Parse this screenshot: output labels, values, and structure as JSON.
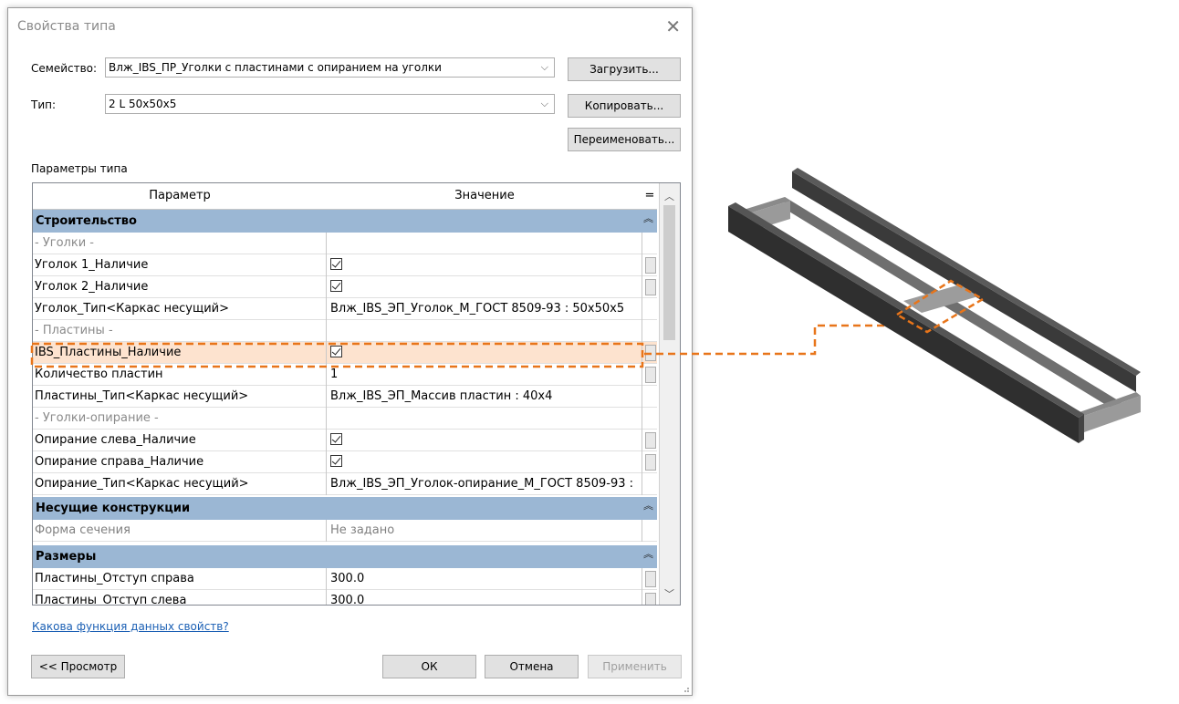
{
  "dialog": {
    "title": "Свойства типа",
    "family_label": "Семейство:",
    "family_value": "Влж_IBS_ПР_Уголки с пластинами с опиранием на уголки",
    "type_label": "Тип:",
    "type_value": "2 L 50x50x5",
    "load_button": "Загрузить...",
    "copy_button": "Копировать...",
    "rename_button": "Переименовать...",
    "params_label": "Параметры типа",
    "help_link": "Какова функция данных свойств?",
    "preview_button": "<< Просмотр",
    "ok_button": "ОК",
    "cancel_button": "Отмена",
    "apply_button": "Применить"
  },
  "grid": {
    "col_param": "Параметр",
    "col_value": "Значение",
    "col_eq": "=",
    "groups": {
      "construction": "Строительство",
      "bearing": "Несущие конструкции",
      "dimensions": "Размеры"
    },
    "rows": {
      "sub_angles": "- Уголки -",
      "angle1": "Уголок 1_Наличие",
      "angle2": "Уголок 2_Наличие",
      "angle_type": "Уголок_Тип<Каркас несущий>",
      "angle_type_val": "Влж_IBS_ЭП_Уголок_М_ГОСТ 8509-93 : 50x50x5",
      "sub_plates": "- Пластины -",
      "plates_present": "IBS_Пластины_Наличие",
      "plates_count": "Количество пластин",
      "plates_count_val": "1",
      "plates_type": "Пластины_Тип<Каркас несущий>",
      "plates_type_val": "Влж_IBS_ЭП_Массив пластин : 40x4",
      "sub_support": "- Уголки-опирание -",
      "support_left": "Опирание слева_Наличие",
      "support_right": "Опирание справа_Наличие",
      "support_type": "Опирание_Тип<Каркас несущий>",
      "support_type_val": "Влж_IBS_ЭП_Уголок-опирание_М_ГОСТ 8509-93 :",
      "section_shape": "Форма сечения",
      "section_shape_val": "Не задано",
      "offset_right": "Пластины_Отступ справа",
      "offset_right_val": "300.0",
      "offset_left": "Пластины_Отступ слева",
      "offset_left_val": "300.0"
    }
  },
  "colors": {
    "group_header": "#9bb7d4",
    "highlight": "#fde3cf",
    "callout": "#e8751a",
    "link": "#1a5fb4"
  }
}
